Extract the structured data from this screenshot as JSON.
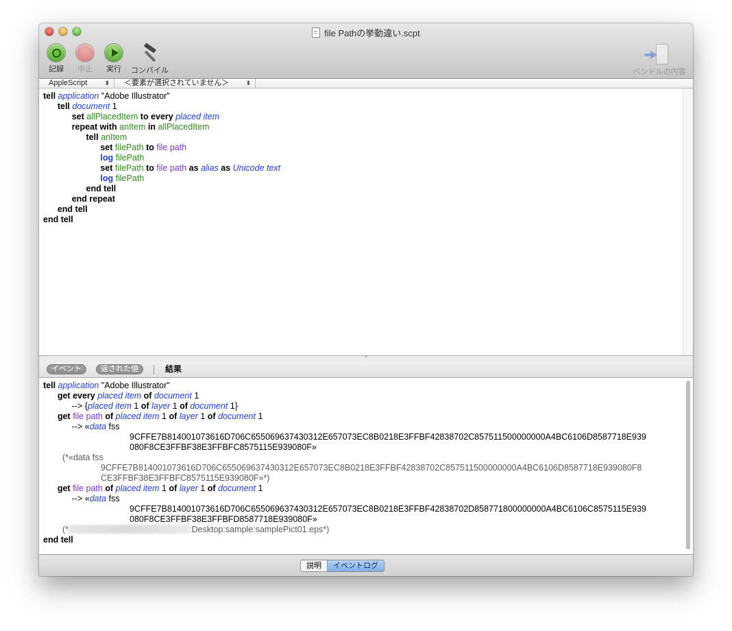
{
  "window": {
    "title": "file Pathの挙動違い.scpt"
  },
  "toolbar": {
    "record": "記録",
    "stop": "中止",
    "run": "実行",
    "compile": "コンパイル",
    "bundle": "バンドルの内容"
  },
  "navigator": {
    "language": "AppleScript",
    "element": "＜要素が選択されていません＞"
  },
  "script_lines": [
    "tell application \"Adobe Illustrator\"",
    "tell document 1",
    "set allPlacedItem to every placed item",
    "repeat with anItem in allPlacedItem",
    "tell anItem",
    "set filePath to file path",
    "log filePath",
    "set filePath to file path as alias as Unicode text",
    "log filePath",
    "end tell",
    "end repeat",
    "end tell",
    "end tell"
  ],
  "log_tabs": {
    "events": "イベント",
    "replies": "返された値",
    "result": "結果"
  },
  "log_lines": [
    "tell application \"Adobe Illustrator\"",
    "get every placed item of document 1",
    "--> {placed item 1 of layer 1 of document 1}",
    "get file path of placed item 1 of layer 1 of document 1",
    "--> «data fss",
    "9CFFE7B814001073616D706C655069637430312E657073EC8B0218E3FFBF42838702C857511500000000A4BC6106D8587718E939",
    "080F8CE3FFBF38E3FFBFC8575115E939080F»",
    "(*«data fss",
    "9CFFE7B814001073616D706C655069637430312E657073EC8B0218E3FFBF42838702C857511500000000A4BC6106D8587718E939080F8",
    "CE3FFBF38E3FFBFC8575115E939080F»*)",
    "get file path of placed item 1 of layer 1 of document 1",
    "--> «data fss",
    "9CFFE7B814001073616D706C655069637430312E657073EC8B0218E3FFBF42838702D858771800000000A4BC6106C8575115E939",
    "080F8CE3FFBF38E3FFBFD8587718E939080F»",
    "(*",
    ":Desktop:sample:samplePict01.eps*)",
    "end tell"
  ],
  "bottom_tabs": {
    "description": "説明",
    "event_log": "イベントログ"
  },
  "colors": {
    "keyword": "#000000",
    "application_class": "#1f40d6",
    "variable": "#2e8b17",
    "property": "#7d32c9",
    "selected_segment": "#7faee8"
  }
}
